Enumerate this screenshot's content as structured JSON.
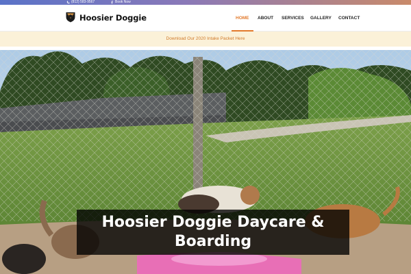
{
  "topbar": {
    "phone": "(812) 583-9567",
    "book_now": "Book Now",
    "phone_icon": "phone-icon",
    "facebook_icon": "facebook-icon"
  },
  "header": {
    "brand": "Hoosier Doggie",
    "logo_icon": "shield-dog-logo",
    "nav": [
      "HOME",
      "ABOUT",
      "SERVICES",
      "GALLERY",
      "CONTACT"
    ],
    "active": "HOME"
  },
  "announcement": {
    "text": "Download Our 2020 Intake Packet Here"
  },
  "hero": {
    "title_line1": "Hoosier Doggie Daycare &",
    "title_line2": "Boarding",
    "image": "photo of dogs playing in a fenced grass yard"
  },
  "colors": {
    "accent": "#e27a2c",
    "announce_bg": "#fbf1d8",
    "topbar_start": "#5a73c8",
    "topbar_end": "#c98a6a"
  }
}
